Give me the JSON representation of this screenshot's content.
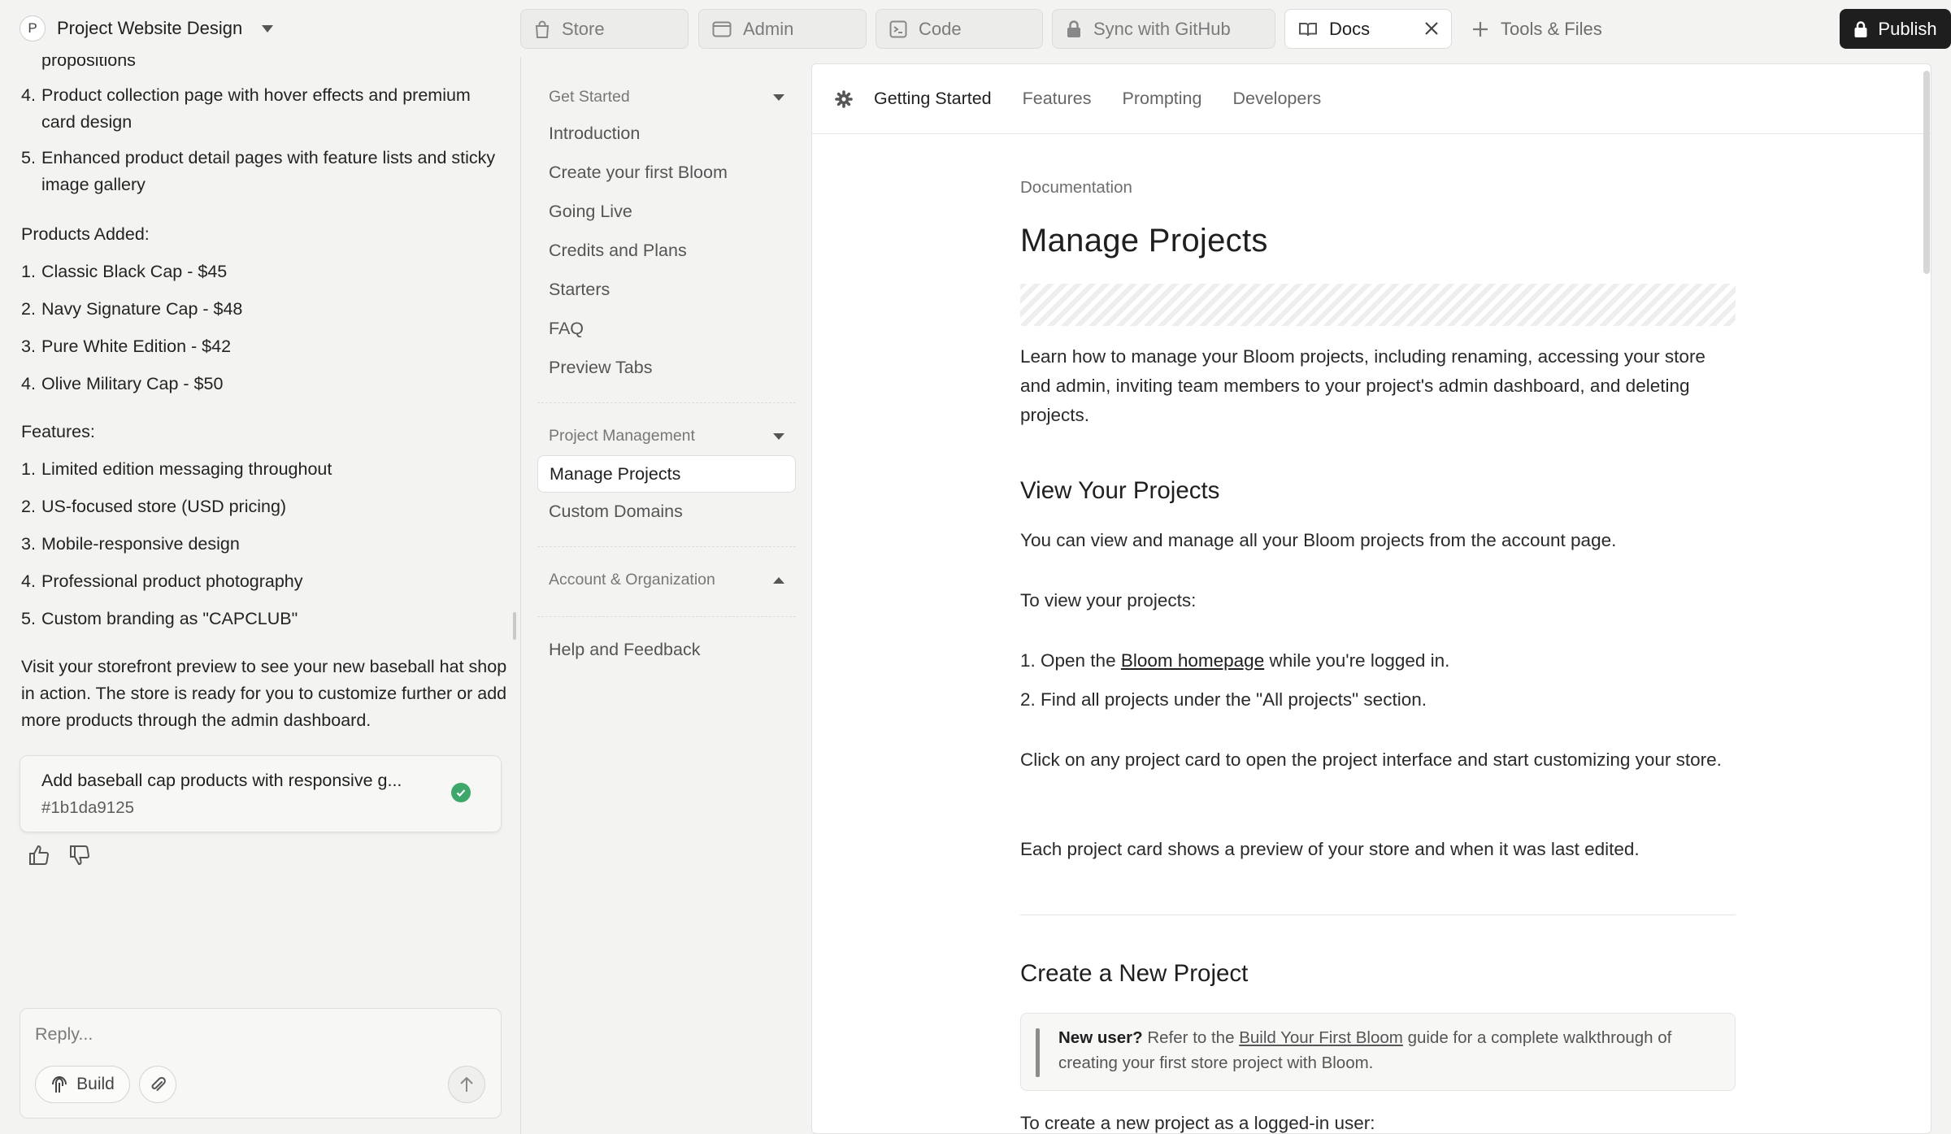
{
  "topbar": {
    "project_initial": "P",
    "project_name": "Project Website Design",
    "tabs": [
      {
        "label": "Store",
        "icon": "bag-icon"
      },
      {
        "label": "Admin",
        "icon": "window-icon"
      },
      {
        "label": "Code",
        "icon": "terminal-icon"
      },
      {
        "label": "Sync with GitHub",
        "icon": "lock-icon"
      },
      {
        "label": "Docs",
        "icon": "book-icon",
        "active": true
      }
    ],
    "tools_label": "Tools & Files",
    "publish_label": "Publish"
  },
  "chat": {
    "top_fragment": "propositions",
    "improvements": [
      {
        "num": "4.",
        "text": "Product collection page with hover effects and premium card design"
      },
      {
        "num": "5.",
        "text": "Enhanced product detail pages with feature lists and sticky image gallery"
      }
    ],
    "products_heading": "Products Added:",
    "products": [
      {
        "num": "1.",
        "text": "Classic Black Cap - $45"
      },
      {
        "num": "2.",
        "text": "Navy Signature Cap - $48"
      },
      {
        "num": "3.",
        "text": "Pure White Edition - $42"
      },
      {
        "num": "4.",
        "text": "Olive Military Cap - $50"
      }
    ],
    "features_heading": "Features:",
    "features": [
      {
        "num": "1.",
        "text": "Limited edition messaging throughout"
      },
      {
        "num": "2.",
        "text": "US-focused store (USD pricing)"
      },
      {
        "num": "3.",
        "text": "Mobile-responsive design"
      },
      {
        "num": "4.",
        "text": "Professional product photography"
      },
      {
        "num": "5.",
        "text": "Custom branding as \"CAPCLUB\""
      }
    ],
    "closing": "Visit your storefront preview to see your new baseball hat shop in action. The store is ready for you to customize further or add more products through the admin dashboard.",
    "task": {
      "title": "Add baseball cap products with responsive g...",
      "id": "#1b1da9125"
    },
    "reply_placeholder": "Reply...",
    "build_label": "Build"
  },
  "docs_nav": {
    "groups": [
      {
        "title": "Get Started",
        "expanded": true,
        "items": [
          "Introduction",
          "Create your first Bloom",
          "Going Live",
          "Credits and Plans",
          "Starters",
          "FAQ",
          "Preview Tabs"
        ]
      },
      {
        "title": "Project Management",
        "expanded": true,
        "items": [
          "Manage Projects",
          "Custom Domains"
        ],
        "active": "Manage Projects"
      },
      {
        "title": "Account & Organization",
        "expanded": false,
        "items": []
      }
    ],
    "footer_link": "Help and Feedback"
  },
  "docs": {
    "tabs": [
      "Getting Started",
      "Features",
      "Prompting",
      "Developers"
    ],
    "active_tab": "Getting Started",
    "eyebrow": "Documentation",
    "title": "Manage Projects",
    "intro": "Learn how to manage your Bloom projects, including renaming, accessing your store and admin, inviting team members to your project's admin dashboard, and deleting projects.",
    "section1": {
      "heading": "View Your Projects",
      "p1": "You can view and manage all your Bloom projects from the account page.",
      "p2": "To view your projects:",
      "step1_pre": "1. Open the ",
      "step1_link": "Bloom homepage",
      "step1_post": " while you're logged in.",
      "step2": "2. Find all projects under the \"All projects\" section.",
      "p3": "Click on any project card to open the project interface and start customizing your store.",
      "p4": "Each project card shows a preview of your store and when it was last edited."
    },
    "section2": {
      "heading": "Create a New Project",
      "callout_bold": "New user?",
      "callout_pre": " Refer to the ",
      "callout_link": "Build Your First Bloom",
      "callout_post": " guide for a complete walkthrough of creating your first store project with Bloom.",
      "p1": "To create a new project as a logged-in user:"
    }
  }
}
